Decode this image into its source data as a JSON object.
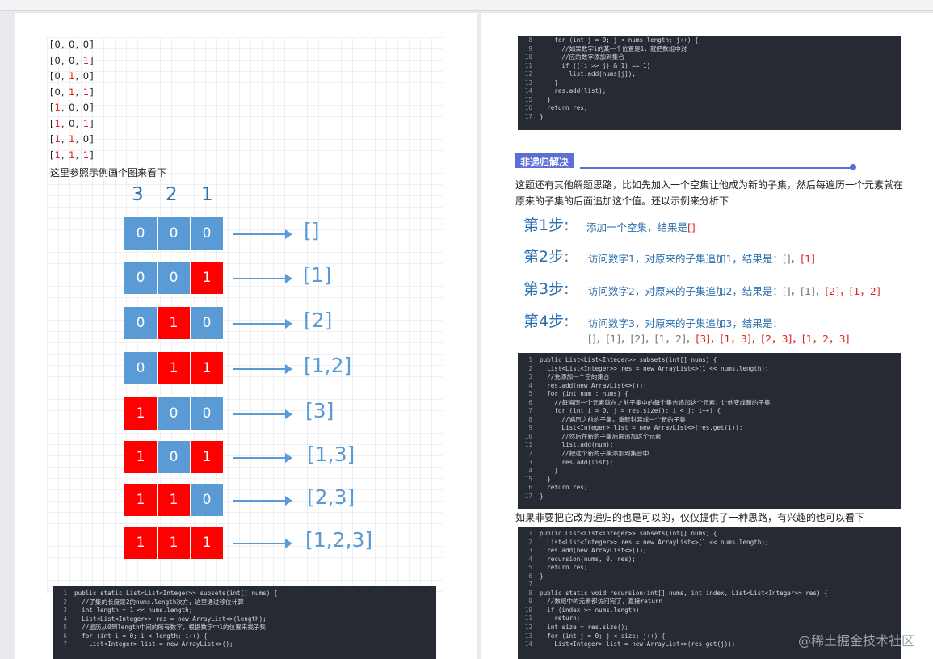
{
  "left": {
    "binary_lines": [
      [
        "0",
        "0",
        "0"
      ],
      [
        "0",
        "0",
        "1"
      ],
      [
        "0",
        "1",
        "0"
      ],
      [
        "0",
        "1",
        "1"
      ],
      [
        "1",
        "0",
        "0"
      ],
      [
        "1",
        "0",
        "1"
      ],
      [
        "1",
        "1",
        "0"
      ],
      [
        "1",
        "1",
        "1"
      ]
    ],
    "caption": "这里参照示例画个图来看下",
    "column_headers": [
      "3",
      "2",
      "1"
    ],
    "diagram_rows": [
      {
        "bits": [
          "0",
          "0",
          "0"
        ],
        "result": "[]"
      },
      {
        "bits": [
          "0",
          "0",
          "1"
        ],
        "result": "[1]"
      },
      {
        "bits": [
          "0",
          "1",
          "0"
        ],
        "result": "[2]"
      },
      {
        "bits": [
          "0",
          "1",
          "1"
        ],
        "result": "[1,2]"
      },
      {
        "bits": [
          "1",
          "0",
          "0"
        ],
        "result": "[3]"
      },
      {
        "bits": [
          "1",
          "0",
          "1"
        ],
        "result": "[1,3]"
      },
      {
        "bits": [
          "1",
          "1",
          "0"
        ],
        "result": "[2,3]"
      },
      {
        "bits": [
          "1",
          "1",
          "1"
        ],
        "result": "[1,2,3]"
      }
    ],
    "code_lines": [
      [
        "1",
        "public static List<List<Integer>> subsets(int[] nums) {"
      ],
      [
        "2",
        "  //子集的长度是2的nums.length次方，这里通过移位计算"
      ],
      [
        "3",
        "  int length = 1 << nums.length;"
      ],
      [
        "4",
        "  List<List<Integer>> res = new ArrayList<>(length);"
      ],
      [
        "5",
        "  //遍历从0到length中间的所有数字，根据数字中1的位置来找子集"
      ],
      [
        "6",
        "  for (int i = 0; i < length; i++) {"
      ],
      [
        "7",
        "    List<Integer> list = new ArrayList<>();"
      ]
    ]
  },
  "right": {
    "top_code_lines": [
      [
        "8",
        "    for (int j = 0; j < nums.length; j++) {"
      ],
      [
        "9",
        "      //如果数字i的某一个位置是1，就把数组中对"
      ],
      [
        "10",
        "      //应的数字添加到集合"
      ],
      [
        "11",
        "      if (((i >> j) & 1) == 1)"
      ],
      [
        "12",
        "        list.add(nums[j]);"
      ],
      [
        "13",
        "    }"
      ],
      [
        "14",
        "    res.add(list);"
      ],
      [
        "15",
        "  }"
      ],
      [
        "16",
        "  return res;"
      ],
      [
        "17",
        "}"
      ]
    ],
    "section_title": "非递归解决",
    "paragraph": "这题还有其他解题思路，比如先加入一个空集让他成为新的子集，然后每遍历一个元素就在原来的子集的后面追加这个值。还以示例来分析下",
    "steps": [
      {
        "label": "第1步:",
        "text": "添加一个空集，结果是",
        "gray": "",
        "red": "[]"
      },
      {
        "label": "第2步:",
        "text": "访问数字1，对原来的子集追加1，结果是：",
        "gray": "[]，",
        "red": "[1]"
      },
      {
        "label": "第3步:",
        "text": "访问数字2，对原来的子集追加2，结果是：",
        "gray": "[]，[1]，",
        "red": "[2]，[1，2]"
      },
      {
        "label": "第4步:",
        "text": "访问数字3，对原来的子集追加3，结果是：",
        "gray": "[]，[1]，[2]，[1，2]，",
        "red": "[3]，[1，3]，[2，3]，[1，2，3]"
      }
    ],
    "code2_lines": [
      [
        "1",
        "public List<List<Integer>> subsets(int[] nums) {"
      ],
      [
        "2",
        "  List<List<Integer>> res = new ArrayList<>(1 << nums.length);"
      ],
      [
        "3",
        "  //先添加一个空的集合"
      ],
      [
        "4",
        "  res.add(new ArrayList<>());"
      ],
      [
        "5",
        "  for (int num : nums) {"
      ],
      [
        "6",
        "    //每遍历一个元素就在之前子集中的每个集合追加这个元素，让他变成新的子集"
      ],
      [
        "7",
        "    for (int i = 0, j = res.size(); i < j; i++) {"
      ],
      [
        "8",
        "      //遍历之前的子集，重新封装成一个新的子集"
      ],
      [
        "9",
        "      List<Integer> list = new ArrayList<>(res.get(i));"
      ],
      [
        "10",
        "      //然后在新的子集后面追加这个元素"
      ],
      [
        "11",
        "      list.add(num);"
      ],
      [
        "12",
        "      //把这个新的子集添加到集合中"
      ],
      [
        "13",
        "      res.add(list);"
      ],
      [
        "14",
        "    }"
      ],
      [
        "15",
        "  }"
      ],
      [
        "16",
        "  return res;"
      ],
      [
        "17",
        "}"
      ]
    ],
    "paragraph2": "如果非要把它改为递归的也是可以的，仅仅提供了一种思路，有兴趣的也可以看下",
    "code3_lines": [
      [
        "1",
        "public List<List<Integer>> subsets(int[] nums) {"
      ],
      [
        "2",
        "  List<List<Integer>> res = new ArrayList<>(1 << nums.length);"
      ],
      [
        "3",
        "  res.add(new ArrayList<>());"
      ],
      [
        "4",
        "  recursion(nums, 0, res);"
      ],
      [
        "5",
        "  return res;"
      ],
      [
        "6",
        "}"
      ],
      [
        "7",
        ""
      ],
      [
        "8",
        "public static void recursion(int[] nums, int index, List<List<Integer>> res) {"
      ],
      [
        "9",
        "  //数组中的元素都访问完了，直接return"
      ],
      [
        "10",
        "  if (index >= nums.length)"
      ],
      [
        "11",
        "    return;"
      ],
      [
        "12",
        "  int size = res.size();"
      ],
      [
        "13",
        "  for (int j = 0; j < size; j++) {"
      ],
      [
        "14",
        "    List<Integer> list = new ArrayList<>(res.get(j));"
      ]
    ]
  },
  "watermark": "@稀土掘金技术社区",
  "colors": {
    "cell_blue": "#5b9bd5",
    "cell_red": "#ff0000",
    "code_bg": "#262a33",
    "section_accent": "#5b6fd6"
  }
}
